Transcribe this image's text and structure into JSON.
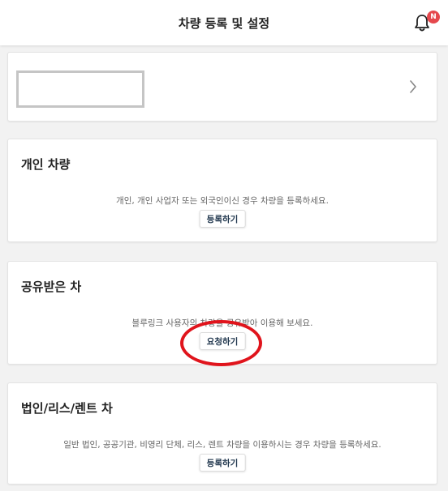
{
  "header": {
    "title": "차량 등록 및 설정",
    "notification_badge": "N"
  },
  "vehicle_card": {
    "chevron_icon": "chevron-right-icon"
  },
  "sections": {
    "personal": {
      "title": "개인 차량",
      "description": "개인, 개인 사업자 또는 외국인이신 경우 차량을 등록하세요.",
      "button": "등록하기"
    },
    "shared": {
      "title": "공유받은 차",
      "description": "블루링크 사용자의 차량을 공유받아 이용해 보세요.",
      "button": "요청하기"
    },
    "corporate": {
      "title": "법인/리스/렌트 차",
      "description": "일반 법인, 공공기관, 비영리 단체, 리스, 렌트 차량을 이용하시는 경우 차량을 등록하세요.",
      "button": "등록하기"
    }
  },
  "colors": {
    "accent_text": "#22384f",
    "badge": "#e5484d",
    "highlight_circle": "#e0141c",
    "background": "#f2f2f2"
  }
}
